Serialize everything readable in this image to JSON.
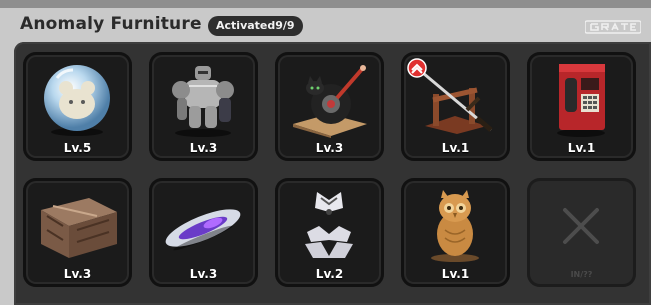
{
  "header": {
    "title": "Anomaly Furniture",
    "badge": "Activated9/9",
    "logo_text": "GRAT E"
  },
  "slots": [
    {
      "name": "crystal-bear-orb",
      "level": "Lv.5"
    },
    {
      "name": "armored-robot",
      "level": "Lv.3"
    },
    {
      "name": "tire-cat-seat",
      "level": "Lv.3"
    },
    {
      "name": "sword-stand",
      "level": "Lv.1"
    },
    {
      "name": "red-payphone",
      "level": "Lv.1"
    },
    {
      "name": "wooden-crate",
      "level": "Lv.3"
    },
    {
      "name": "hover-board",
      "level": "Lv.3"
    },
    {
      "name": "maid-apron",
      "level": "Lv.2"
    },
    {
      "name": "owl-statue",
      "level": "Lv.1"
    },
    {
      "name": "empty-slot",
      "level": "",
      "locked_caption": "IN/??"
    }
  ],
  "colors": {
    "background": "#c9c9c9",
    "panel": "#333333",
    "slot": "#1b1b1b",
    "badge": "#2e2e2e",
    "alert": "#e03030"
  }
}
